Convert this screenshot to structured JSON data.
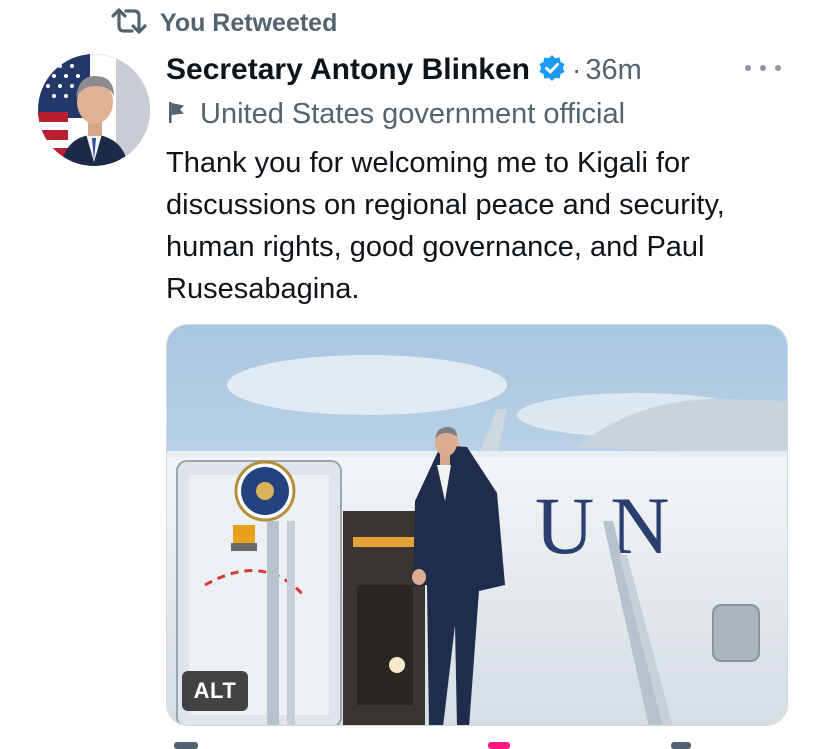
{
  "retweet": {
    "label": "You Retweeted",
    "icon": "retweet-icon"
  },
  "author": {
    "display_name": "Secretary Antony Blinken",
    "verified_icon": "verified-badge-icon",
    "separator": "·",
    "time": "36m",
    "label": "United States government official",
    "label_icon": "flag-icon"
  },
  "tweet": {
    "text": "Thank you for welcoming me to Kigali for discussions on regional peace and security, human rights, good governance, and Paul Rusesabagina."
  },
  "media": {
    "alt_label": "ALT",
    "plane_lettering": "UN"
  },
  "colors": {
    "accent": "#1d9bf0",
    "secondary_text": "#536471",
    "primary_text": "#0f1419"
  }
}
